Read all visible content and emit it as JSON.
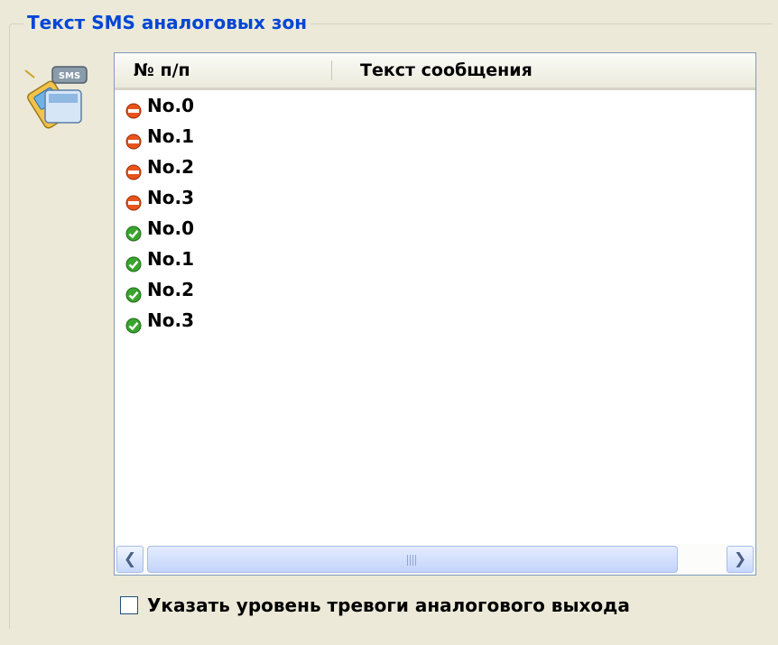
{
  "group": {
    "title": "Текст SMS аналоговых зон"
  },
  "icons": {
    "group_icon": "sms-phone-icon",
    "status_red": "stop-icon",
    "status_green": "check-icon"
  },
  "colors": {
    "title": "#0046d5",
    "status_red": "#e8541c",
    "status_green": "#3aa52e"
  },
  "list": {
    "columns": [
      "№ п/п",
      "Текст сообщения"
    ],
    "rows": [
      {
        "status": "red",
        "label": "No.0",
        "text": ""
      },
      {
        "status": "red",
        "label": "No.1",
        "text": ""
      },
      {
        "status": "red",
        "label": "No.2",
        "text": ""
      },
      {
        "status": "red",
        "label": "No.3",
        "text": ""
      },
      {
        "status": "green",
        "label": "No.0",
        "text": ""
      },
      {
        "status": "green",
        "label": "No.1",
        "text": ""
      },
      {
        "status": "green",
        "label": "No.2",
        "text": ""
      },
      {
        "status": "green",
        "label": "No.3",
        "text": ""
      }
    ]
  },
  "checkbox": {
    "label": "Указать уровень тревоги аналогового выхода",
    "checked": false
  }
}
